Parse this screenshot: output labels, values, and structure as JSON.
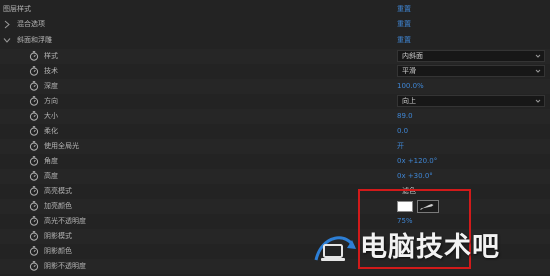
{
  "rows": {
    "layer_styles": {
      "label": "图层样式",
      "value": "重置"
    },
    "blend_options": {
      "label": "混合选项",
      "value": "重置"
    },
    "bevel_emboss": {
      "label": "斜面和浮雕",
      "value": "重置"
    },
    "style": {
      "label": "样式",
      "value": "内斜面"
    },
    "technique": {
      "label": "技术",
      "value": "平滑"
    },
    "depth": {
      "label": "深度",
      "value": "100.0%"
    },
    "direction": {
      "label": "方向",
      "value": "向上"
    },
    "size": {
      "label": "大小",
      "value": "89.0"
    },
    "soften": {
      "label": "柔化",
      "value": "0.0"
    },
    "global_light": {
      "label": "使用全局光",
      "value": "开"
    },
    "angle": {
      "label": "角度",
      "value": "0x +120.0°"
    },
    "altitude": {
      "label": "高度",
      "value": "0x +30.0°"
    },
    "highlight_mode": {
      "label": "高亮模式",
      "value": "滤色"
    },
    "highlight_color": {
      "label": "加亮颜色",
      "color": "#ffffff"
    },
    "highlight_opacity": {
      "label": "高光不透明度",
      "value": "75%"
    },
    "shadow_mode": {
      "label": "阴影模式"
    },
    "shadow_color": {
      "label": "阴影颜色"
    },
    "shadow_opacity": {
      "label": "阴影不透明度"
    }
  },
  "icons": {
    "stopwatch": "stopwatch-icon",
    "expand": "chevron-right-icon",
    "collapse": "chevron-down-icon",
    "eyedropper": "eyedropper-icon"
  },
  "watermark": {
    "text": "电脑技术吧"
  },
  "colors": {
    "panel_bg": "#232323",
    "value_blue": "#3f86d4",
    "highlight_box": "#d21a1a"
  }
}
